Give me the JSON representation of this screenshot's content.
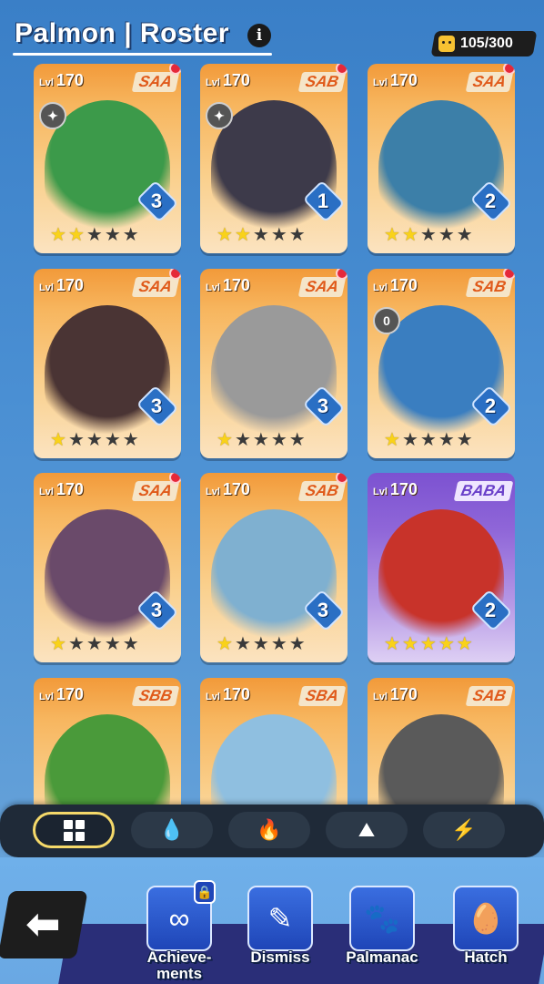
{
  "header": {
    "title": "Palmon | Roster",
    "info_icon": "i",
    "counter": "105/300"
  },
  "cards": [
    {
      "lvl_prefix": "Lvl",
      "level": "170",
      "grade": "SAA",
      "count": "3",
      "stars": 2,
      "color": "orange",
      "rank_icon": "shuriken-icon",
      "rank_text": "",
      "notification": true,
      "monster_color": "#3c9a4a"
    },
    {
      "lvl_prefix": "Lvl",
      "level": "170",
      "grade": "SAB",
      "count": "1",
      "stars": 2,
      "color": "orange",
      "rank_icon": "shuriken-icon",
      "rank_text": "",
      "notification": true,
      "monster_color": "#3d3a4a"
    },
    {
      "lvl_prefix": "Lvl",
      "level": "170",
      "grade": "SAA",
      "count": "2",
      "stars": 2,
      "color": "orange",
      "rank_icon": "",
      "rank_text": "",
      "notification": true,
      "monster_color": "#3c7fa8"
    },
    {
      "lvl_prefix": "Lvl",
      "level": "170",
      "grade": "SAA",
      "count": "3",
      "stars": 1,
      "color": "orange",
      "rank_icon": "",
      "rank_text": "",
      "notification": true,
      "monster_color": "#4a3434"
    },
    {
      "lvl_prefix": "Lvl",
      "level": "170",
      "grade": "SAA",
      "count": "3",
      "stars": 1,
      "color": "orange",
      "rank_icon": "",
      "rank_text": "",
      "notification": true,
      "monster_color": "#9a9a9a"
    },
    {
      "lvl_prefix": "Lvl",
      "level": "170",
      "grade": "SAB",
      "count": "2",
      "stars": 1,
      "color": "orange",
      "rank_icon": "rank-icon",
      "rank_text": "0",
      "notification": true,
      "monster_color": "#3a7ec0"
    },
    {
      "lvl_prefix": "Lvl",
      "level": "170",
      "grade": "SAA",
      "count": "3",
      "stars": 1,
      "color": "orange",
      "rank_icon": "",
      "rank_text": "",
      "notification": true,
      "monster_color": "#6a4a6a"
    },
    {
      "lvl_prefix": "Lvl",
      "level": "170",
      "grade": "SAB",
      "count": "3",
      "stars": 1,
      "color": "orange",
      "rank_icon": "",
      "rank_text": "",
      "notification": true,
      "monster_color": "#7fb0d0"
    },
    {
      "lvl_prefix": "Lvl",
      "level": "170",
      "grade": "BABA",
      "count": "2",
      "stars": 5,
      "color": "purple",
      "rank_icon": "",
      "rank_text": "",
      "notification": false,
      "monster_color": "#c8332a"
    },
    {
      "lvl_prefix": "Lvl",
      "level": "170",
      "grade": "SBB",
      "count": "",
      "stars": 0,
      "color": "orange",
      "rank_icon": "",
      "rank_text": "",
      "notification": false,
      "monster_color": "#4a9a3a"
    },
    {
      "lvl_prefix": "Lvl",
      "level": "170",
      "grade": "SBA",
      "count": "",
      "stars": 0,
      "color": "orange",
      "rank_icon": "",
      "rank_text": "",
      "notification": false,
      "monster_color": "#8fbfe0"
    },
    {
      "lvl_prefix": "Lvl",
      "level": "170",
      "grade": "SAB",
      "count": "",
      "stars": 0,
      "color": "orange",
      "rank_icon": "",
      "rank_text": "",
      "notification": false,
      "monster_color": "#5a5a5a"
    }
  ],
  "filters": [
    {
      "name": "all-icon",
      "active": true
    },
    {
      "name": "water-icon",
      "glyph": "💧",
      "active": false
    },
    {
      "name": "fire-icon",
      "glyph": "🔥",
      "active": false
    },
    {
      "name": "earth-icon",
      "glyph": "⛰",
      "active": false
    },
    {
      "name": "electric-icon",
      "glyph": "⚡",
      "active": false
    }
  ],
  "nav": {
    "back_icon": "back-arrow-icon",
    "items": [
      {
        "label": "Achieve-\nments",
        "icon": "achievements-icon",
        "glyph": "∞",
        "locked": true
      },
      {
        "label": "Dismiss",
        "icon": "dismiss-icon",
        "glyph": "✎",
        "locked": false
      },
      {
        "label": "Palmanac",
        "icon": "palmanac-icon",
        "glyph": "🐾",
        "locked": false
      },
      {
        "label": "Hatch",
        "icon": "egg-icon",
        "glyph": "🥚",
        "locked": false
      }
    ]
  }
}
